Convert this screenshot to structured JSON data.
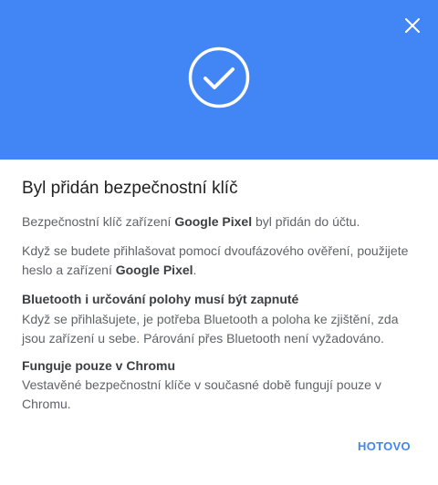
{
  "header": {
    "background_color": "#4285f4",
    "close_icon": "close-icon",
    "status_icon": "check-circle-icon"
  },
  "dialog": {
    "title": "Byl přidán bezpečnostní klíč",
    "p1_before": "Bezpečnostní klíč zařízení ",
    "p1_device": "Google Pixel",
    "p1_after": " byl přidán do účtu.",
    "p2_before": "Když se budete přihlašovat pomocí dvoufázového ověření, použijete heslo a zařízení ",
    "p2_device": "Google Pixel",
    "p2_after": ".",
    "section1_heading": "Bluetooth i určování polohy musí být zapnuté",
    "section1_text": "Když se přihlašujete, je potřeba Bluetooth a poloha ke zjištění, zda jsou zařízení u sebe. Párování přes Bluetooth není vyžadováno.",
    "section2_heading": "Funguje pouze v Chromu",
    "section2_text": "Vestavěné bezpečnostní klíče v současné době fungují pouze v Chromu."
  },
  "actions": {
    "done_label": "HOTOVO",
    "accent_color": "#4285f4"
  }
}
